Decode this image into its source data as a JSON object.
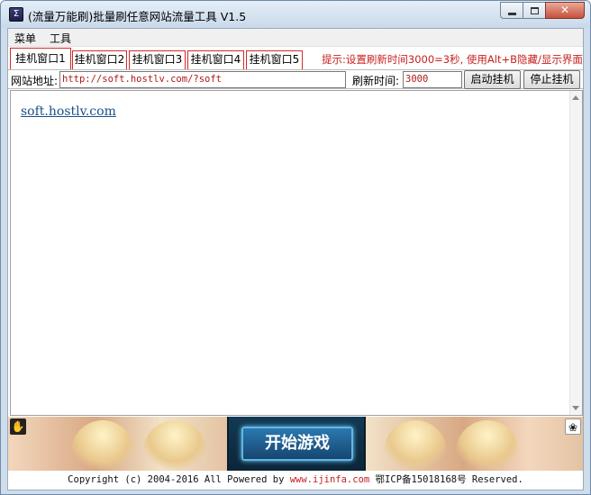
{
  "window": {
    "title": "(流量万能刷)批量刷任意网站流量工具 V1.5",
    "app_icon_glyph": "Σ",
    "close_glyph": "✕"
  },
  "menubar": {
    "items": [
      "菜单",
      "工具"
    ]
  },
  "tabs": [
    {
      "label": "挂机窗口1",
      "active": true
    },
    {
      "label": "挂机窗口2",
      "active": false
    },
    {
      "label": "挂机窗口3",
      "active": false
    },
    {
      "label": "挂机窗口4",
      "active": false
    },
    {
      "label": "挂机窗口5",
      "active": false
    }
  ],
  "hint": "提示:设置刷新时间3000=3秒, 使用Alt+B隐藏/显示界面",
  "address": {
    "label": "网站地址:",
    "value": "http://soft.hostlv.com/?soft"
  },
  "refresh": {
    "label": "刷新时间:",
    "value": "3000"
  },
  "buttons": {
    "start": "启动挂机",
    "stop": "停止挂机"
  },
  "webview": {
    "link_text": "soft.hostlv.com"
  },
  "banner": {
    "play_label": "开始游戏",
    "left_corner_icon": "hand-icon",
    "right_corner_icon": "paw-icon"
  },
  "footer": {
    "prefix": "Copyright (c) 2004-2016 All Powered by ",
    "site": "www.ijinfa.com",
    "suffix": " 鄂ICP备15018168号 Reserved."
  },
  "colors": {
    "accent_red": "#c81e1e",
    "link_blue": "#1a4f88",
    "tab_border": "#d42a2a"
  }
}
